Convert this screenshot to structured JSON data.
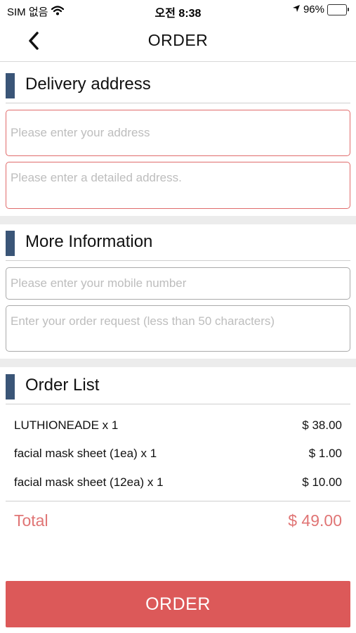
{
  "status_bar": {
    "carrier": "SIM 없음",
    "time": "오전 8:38",
    "battery_percent": "96%",
    "battery_level": 0.96
  },
  "header": {
    "title": "ORDER",
    "back_icon": "chevron-left-icon"
  },
  "delivery": {
    "title": "Delivery address",
    "address_placeholder": "Please enter your address",
    "detail_placeholder": "Please enter a detailed address."
  },
  "more_info": {
    "title": "More Information",
    "mobile_placeholder": "Please enter your mobile number",
    "request_placeholder": "Enter your order request (less than 50 characters)"
  },
  "order_list": {
    "title": "Order List",
    "items": [
      {
        "name": "LUTHIONEADE x 1",
        "price": "$ 38.00"
      },
      {
        "name": "facial mask sheet (1ea) x 1",
        "price": "$ 1.00"
      },
      {
        "name": "facial mask sheet (12ea) x 1",
        "price": "$ 10.00"
      }
    ],
    "total_label": "Total",
    "total_value": "$ 49.00"
  },
  "submit": {
    "label": "ORDER"
  },
  "colors": {
    "accent": "#dc5959",
    "section_bar": "#3a5577",
    "error_border": "#e06b6b",
    "total_text": "#e07575"
  }
}
